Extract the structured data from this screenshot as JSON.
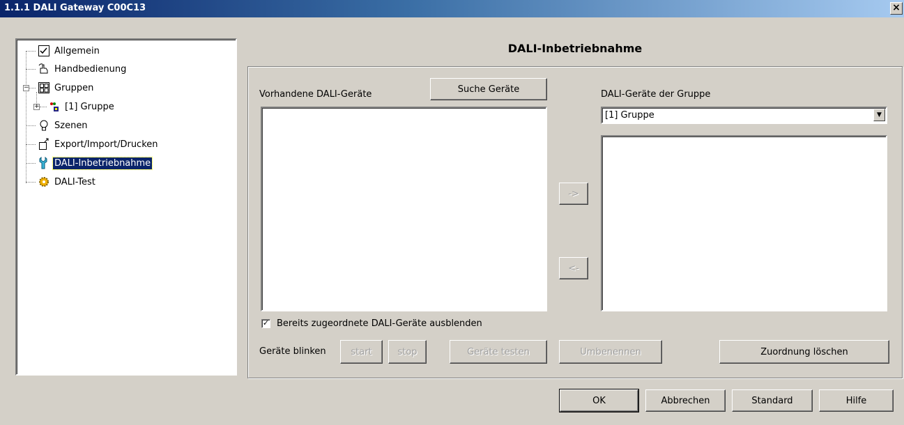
{
  "window": {
    "title": "1.1.1 DALI Gateway C00C13",
    "close_glyph": "×"
  },
  "tree": {
    "items": [
      {
        "label": "Allgemein",
        "icon": "general-settings-icon"
      },
      {
        "label": "Handbedienung",
        "icon": "hand-operation-icon"
      },
      {
        "label": "Gruppen",
        "icon": "groups-icon"
      },
      {
        "label": "[1] Gruppe",
        "icon": "group-icon"
      },
      {
        "label": "Szenen",
        "icon": "scene-bulb-icon"
      },
      {
        "label": "Export/Import/Drucken",
        "icon": "export-import-icon"
      },
      {
        "label": "DALI-Inbetriebnahme",
        "icon": "commissioning-wrench-icon"
      },
      {
        "label": "DALI-Test",
        "icon": "test-gear-icon"
      }
    ],
    "selected": "DALI-Inbetriebnahme"
  },
  "panel": {
    "heading": "DALI-Inbetriebnahme",
    "available_label": "Vorhandene DALI-Geräte",
    "search_button": "Suche Geräte",
    "group_devices_label": "DALI-Geräte der Gruppe",
    "group_select_value": "[1] Gruppe",
    "move_right_button": "->",
    "move_left_button": "<-",
    "hide_assigned_checkbox": {
      "label": "Bereits zugeordnete DALI-Geräte ausblenden",
      "checked": true
    },
    "blink_label": "Geräte blinken",
    "start_button": "start",
    "stop_button": "stop",
    "test_button": "Geräte testen",
    "rename_button": "Umbenennen",
    "clear_assignment_button": "Zuordnung löschen"
  },
  "footer": {
    "ok_button": "OK",
    "cancel_button": "Abbrechen",
    "default_button": "Standard",
    "help_button": "Hilfe"
  }
}
